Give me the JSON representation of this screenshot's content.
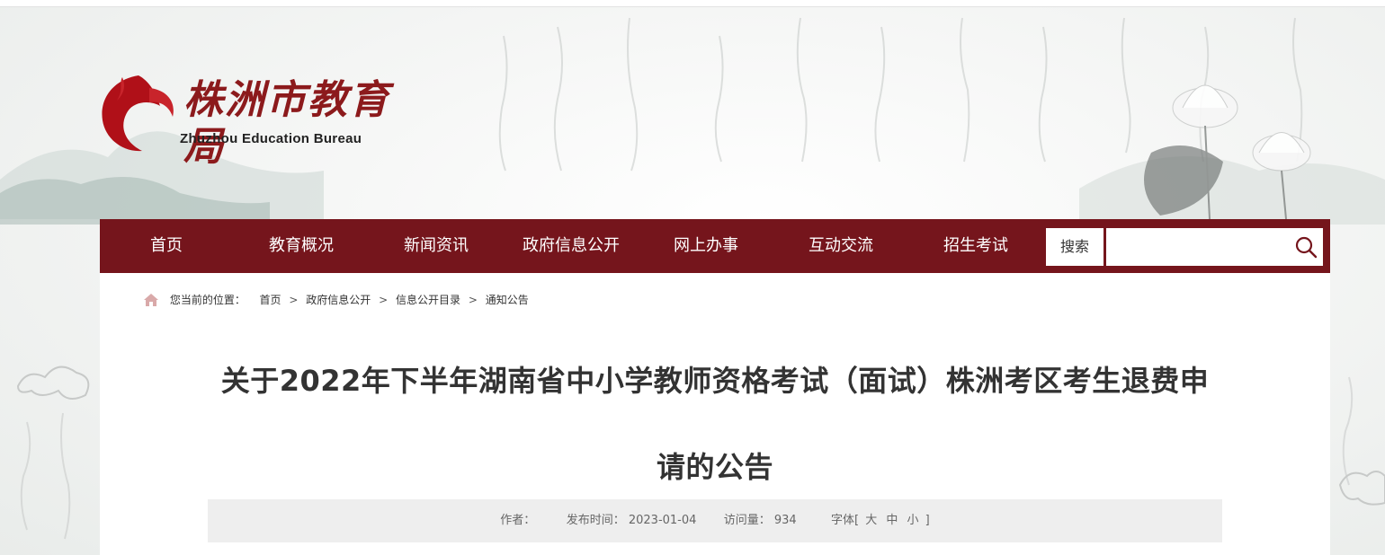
{
  "logo": {
    "name_cn": "株洲市教育局",
    "name_en": "Zhuzhou Education Bureau"
  },
  "nav": {
    "items": [
      {
        "label": "首页"
      },
      {
        "label": "教育概况"
      },
      {
        "label": "新闻资讯"
      },
      {
        "label": "政府信息公开"
      },
      {
        "label": "网上办事"
      },
      {
        "label": "互动交流"
      },
      {
        "label": "招生考试"
      }
    ],
    "search_label": "搜索",
    "search_value": ""
  },
  "breadcrumb": {
    "prefix": "您当前的位置：",
    "items": [
      "首页",
      "政府信息公开",
      "信息公开目录",
      "通知公告"
    ],
    "separator": ">"
  },
  "article": {
    "title_line1": "关于2022年下半年湖南省中小学教师资格考试（面试）株洲考区考生退费申",
    "title_line2": "请的公告",
    "author_label": "作者：",
    "author_value": "",
    "date_label": "发布时间：",
    "date_value": "2023-01-04",
    "views_label": "访问量：",
    "views_value": "934",
    "font_label": "字体[",
    "font_large": "大",
    "font_medium": "中",
    "font_small": "小",
    "font_close": "]"
  },
  "colors": {
    "brand": "#75151c",
    "logo_red": "#b01018",
    "panel": "#ffffff",
    "meta_bg": "#eeeeee"
  },
  "icons": {
    "home": "home-icon",
    "search": "search-icon",
    "logo_mark": "flame-logo-icon"
  }
}
